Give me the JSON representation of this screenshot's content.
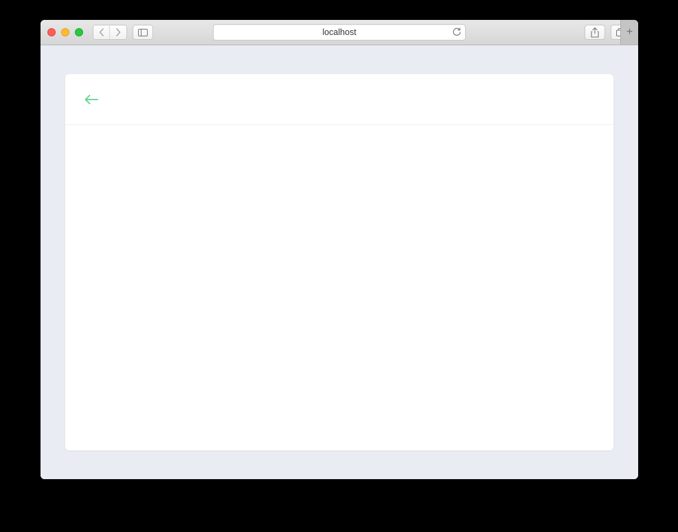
{
  "browser": {
    "address": "localhost"
  },
  "colors": {
    "accent_green": "#5bd38f",
    "page_bg": "#e9ecf2"
  }
}
